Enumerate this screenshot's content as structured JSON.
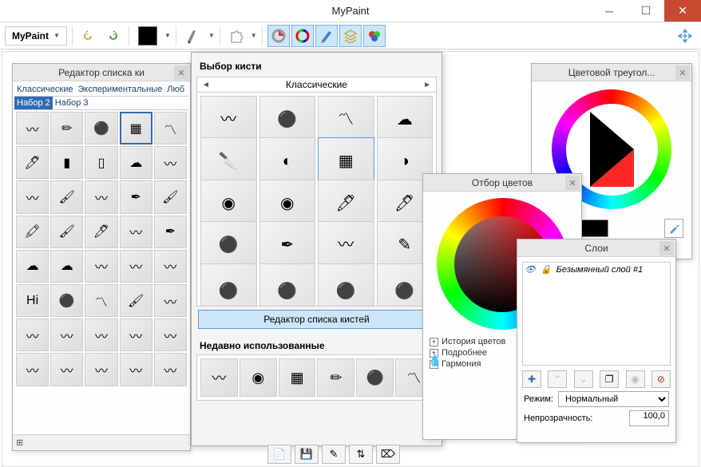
{
  "window": {
    "title": "MyPaint"
  },
  "menu": {
    "label": "MyPaint"
  },
  "toolbar": {
    "items": [
      "undo",
      "redo",
      "color",
      "brush",
      "plugin",
      "gradient-ring",
      "ring",
      "brush2",
      "layers",
      "mix"
    ]
  },
  "brushEditor": {
    "title": "Редактор списка ки",
    "tabs1": [
      "Классические",
      "Экспериментальные",
      "Люб"
    ],
    "tabs2": [
      "Набор 2",
      "Набор 3"
    ],
    "selectedTab": "Набор 2"
  },
  "brushChooser": {
    "title": "Выбор кисти",
    "category": "Классические",
    "brushes": [
      {
        "name": "pencil"
      },
      {
        "name": "charcoal"
      },
      {
        "name": "dry-brush"
      },
      {
        "name": "rounded"
      },
      {
        "name": "knife"
      },
      {
        "name": "smudge+paint"
      },
      {
        "name": "ink-eraser",
        "selected": true
      },
      {
        "name": "blend+paint"
      },
      {
        "name": "modelling2"
      },
      {
        "name": "modelling"
      },
      {
        "name": "marker-fat"
      },
      {
        "name": "marker-small"
      },
      {
        "name": "kabura"
      },
      {
        "name": "pen"
      },
      {
        "name": "slow-ink"
      },
      {
        "name": "pointy-ink"
      }
    ],
    "editorBtn": "Редактор списка кистей",
    "recentTitle": "Недавно использованные"
  },
  "colorTri": {
    "title": "Цветовой треугол..."
  },
  "colorPick": {
    "title": "Отбор цветов",
    "expanders": [
      "История цветов",
      "Подробнее",
      "Гармония"
    ]
  },
  "layers": {
    "title": "Слои",
    "layerName": "Безымянный слой #1",
    "modeLabel": "Режим:",
    "modeValue": "Нормальный",
    "opacityLabel": "Непрозрачность:",
    "opacityValue": "100,0"
  },
  "footer": {
    "plus": "⊞"
  }
}
